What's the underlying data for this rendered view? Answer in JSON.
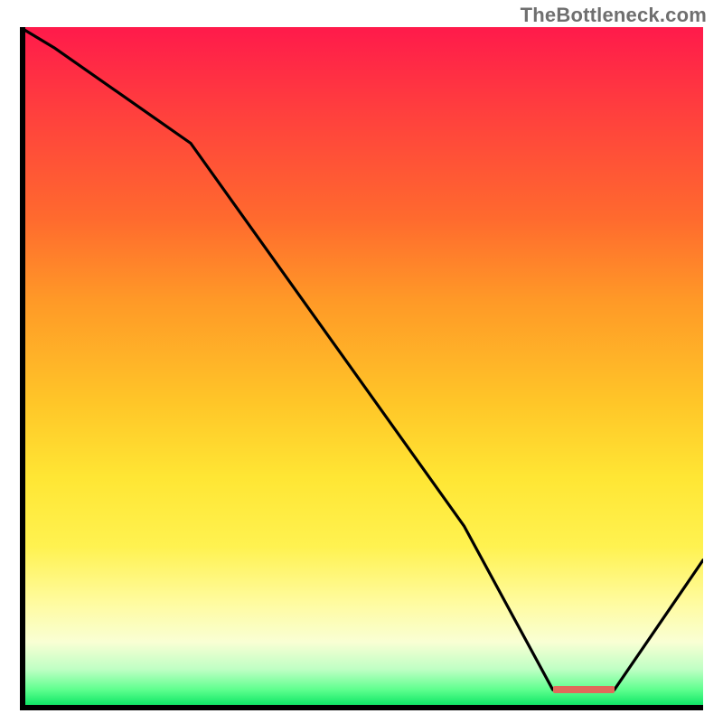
{
  "watermark": "TheBottleneck.com",
  "colors": {
    "axis": "#000000",
    "line": "#000000",
    "marker": "#e06a5a",
    "gradient_top": "#ff1a4b",
    "gradient_bottom": "#0dc75c"
  },
  "chart_data": {
    "type": "line",
    "title": "",
    "xlabel": "",
    "ylabel": "",
    "xlim": [
      0,
      100
    ],
    "ylim": [
      0,
      100
    ],
    "x": [
      0,
      5,
      15,
      25,
      65,
      78,
      87,
      100
    ],
    "values": [
      100,
      97,
      90,
      83,
      27,
      3,
      3,
      22
    ],
    "marker": {
      "x_start": 78,
      "x_end": 87,
      "y": 3
    }
  }
}
